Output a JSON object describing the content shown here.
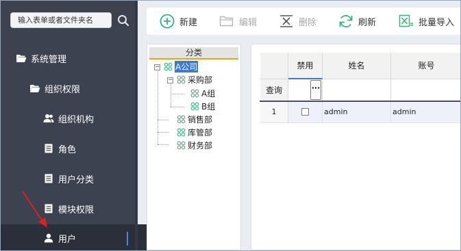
{
  "sidebar": {
    "search_placeholder": "输入表单或者文件夹名",
    "items": [
      {
        "label": "系统管理",
        "icon": "folder-open-icon"
      },
      {
        "label": "组织权限",
        "icon": "folder-open-icon"
      },
      {
        "label": "组织机构",
        "icon": "users-icon"
      },
      {
        "label": "角色",
        "icon": "document-icon"
      },
      {
        "label": "用户分类",
        "icon": "document-icon"
      },
      {
        "label": "模块权限",
        "icon": "document-icon"
      },
      {
        "label": "用户",
        "icon": "user-icon",
        "active": true
      }
    ]
  },
  "toolbar": {
    "new_label": "新建",
    "edit_label": "编辑",
    "delete_label": "删除",
    "refresh_label": "刷新",
    "import_label": "批量导入"
  },
  "tree": {
    "header": "分类",
    "nodes": [
      {
        "label": "A公司",
        "selected": true
      },
      {
        "label": "采购部"
      },
      {
        "label": "A组"
      },
      {
        "label": "B组"
      },
      {
        "label": "销售部"
      },
      {
        "label": "库管部"
      },
      {
        "label": "财务部"
      }
    ]
  },
  "grid": {
    "columns": [
      "禁用",
      "姓名",
      "账号"
    ],
    "filter_label": "查询",
    "filter_button": "···",
    "rows": [
      {
        "index": "1",
        "name": "admin",
        "account": "admin"
      }
    ]
  },
  "colors": {
    "sidebar_bg": "#3d4250",
    "accent": "#3c78d8",
    "new_icon": "#2fb67c",
    "refresh_icon": "#2fb67c",
    "import_icon": "#2fb67c",
    "arrow": "#e02020"
  }
}
